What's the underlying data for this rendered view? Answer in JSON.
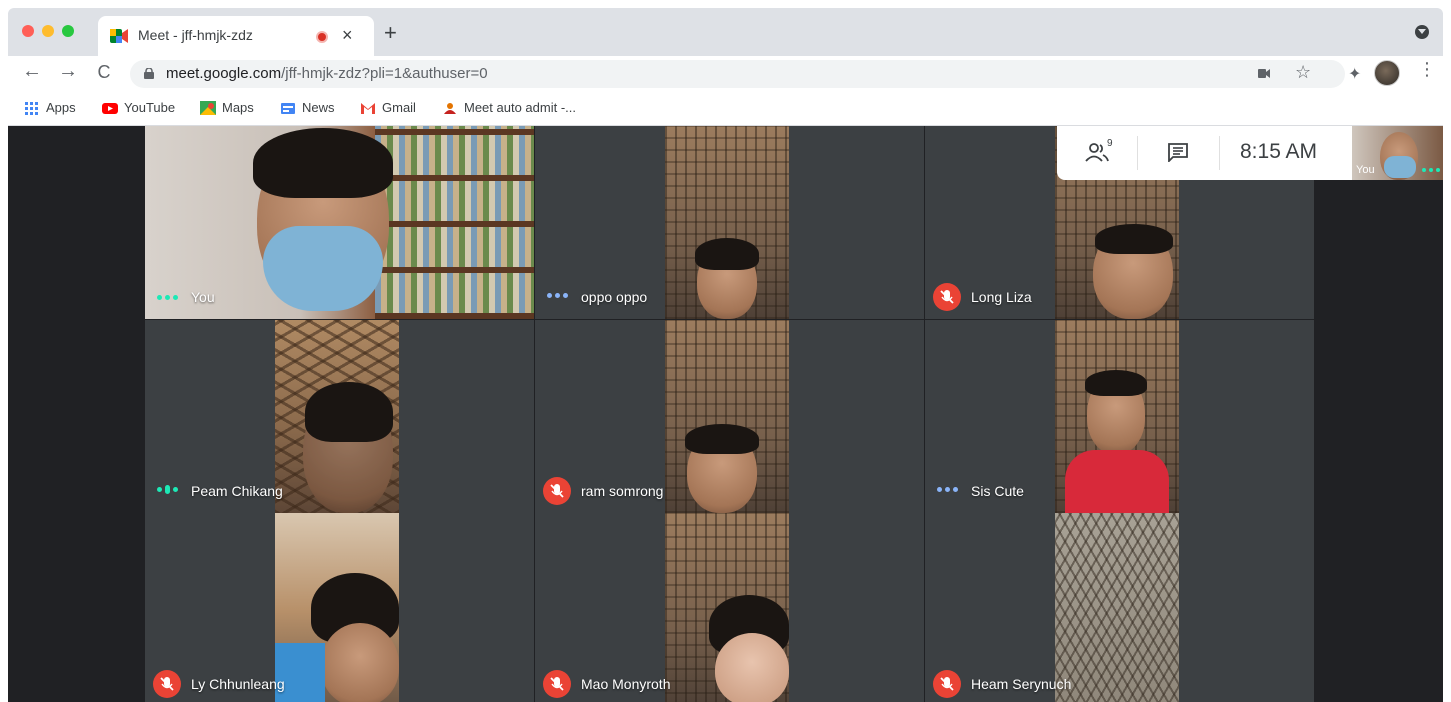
{
  "browser": {
    "tab": {
      "title": "Meet - jff-hmjk-zdz",
      "close": "×"
    },
    "new_tab": "+",
    "url": {
      "host": "meet.google.com",
      "path": "/jff-hmjk-zdz?pli=1&authuser=0"
    },
    "nav": {
      "back": "←",
      "forward": "→",
      "reload": "C"
    },
    "star": "☆",
    "menu": "⋮",
    "bookmarks": [
      {
        "label": "Apps",
        "icon": "apps-grid-icon"
      },
      {
        "label": "YouTube",
        "icon": "youtube-icon"
      },
      {
        "label": "Maps",
        "icon": "maps-icon"
      },
      {
        "label": "News",
        "icon": "news-icon"
      },
      {
        "label": "Gmail",
        "icon": "gmail-icon"
      },
      {
        "label": "Meet auto admit -...",
        "icon": "meet-auto-admit-icon"
      }
    ]
  },
  "meet": {
    "info": {
      "participant_count": "9",
      "time": "8:15 AM"
    },
    "self_thumbnail_label": "You",
    "participants": [
      {
        "name": "You",
        "status": "speaking-dots"
      },
      {
        "name": "oppo oppo",
        "status": "dots"
      },
      {
        "name": "Long Liza",
        "status": "muted"
      },
      {
        "name": "Peam Chikang",
        "status": "speaking"
      },
      {
        "name": "ram somrong",
        "status": "muted"
      },
      {
        "name": "Sis Cute",
        "status": "dots"
      },
      {
        "name": "Ly Chhunleang",
        "status": "muted"
      },
      {
        "name": "Mao Monyroth",
        "status": "muted"
      },
      {
        "name": "Heam Serynuch",
        "status": "muted"
      }
    ]
  },
  "colors": {
    "meet_background": "#202124",
    "mute_red": "#ea4335",
    "speaking_teal": "#1de9b6",
    "dots_blue": "#8ab4f8",
    "record_red": "#d93025"
  }
}
